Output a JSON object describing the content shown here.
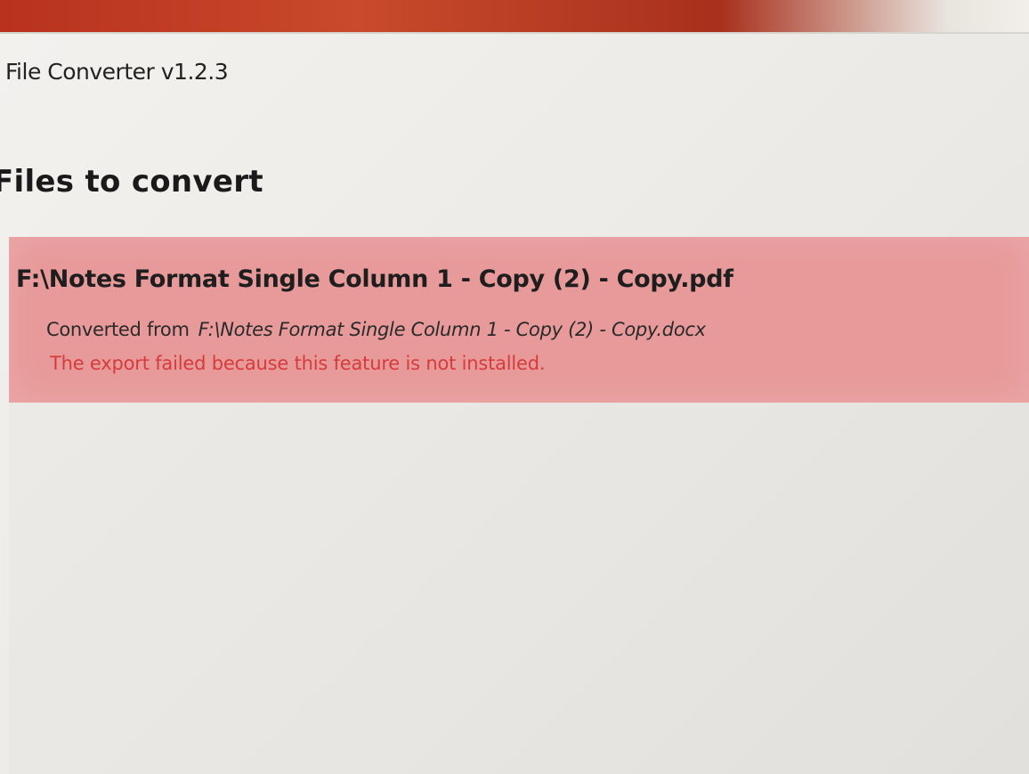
{
  "window": {
    "title": "File Converter v1.2.3"
  },
  "main": {
    "heading": "Files to convert",
    "files": [
      {
        "output_path": "F:\\Notes Format Single Column 1 - Copy (2) - Copy.pdf",
        "converted_from_label": "Converted from",
        "source_path": "F:\\Notes Format Single Column 1 - Copy (2) - Copy.docx",
        "error_message": "The export failed because this feature is not installed.",
        "status_color": "#e89a9a",
        "error_color": "#d63b3b"
      }
    ]
  }
}
